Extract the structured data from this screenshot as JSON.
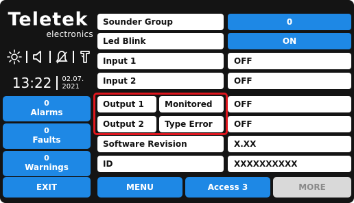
{
  "brand": {
    "name": "Teletek",
    "tagline": "electronics"
  },
  "status_icons": [
    "sun-icon",
    "speaker-icon",
    "bell-off-icon",
    "fire-icon"
  ],
  "clock": {
    "time": "13:22",
    "date_day_month": "02.07.",
    "date_year": "2021"
  },
  "counters": [
    {
      "count": "0",
      "label": "Alarms"
    },
    {
      "count": "0",
      "label": "Faults"
    },
    {
      "count": "0",
      "label": "Warnings"
    }
  ],
  "rows": {
    "sounder_group": {
      "label": "Sounder Group",
      "value": "0"
    },
    "led_blink": {
      "label": "Led Blink",
      "value": "ON"
    },
    "input_1": {
      "label": "Input 1",
      "value": "OFF"
    },
    "input_2": {
      "label": "Input 2",
      "value": "OFF"
    },
    "output_1": {
      "label": "Output 1",
      "type": "Monitored",
      "value": "OFF"
    },
    "output_2": {
      "label": "Output 2",
      "type": "Type Error",
      "value": "OFF"
    },
    "software_revision": {
      "label": "Software Revision",
      "value": "X.XX"
    },
    "id": {
      "label": "ID",
      "value": "XXXXXXXXXX"
    }
  },
  "bottom_bar": {
    "exit": "EXIT",
    "menu": "MENU",
    "access": "Access 3",
    "more": "MORE"
  },
  "colors": {
    "background": "#141414",
    "accent_blue": "#1e88e5",
    "highlight_red": "#e0161e",
    "disabled_gray": "#d9d9d9"
  }
}
